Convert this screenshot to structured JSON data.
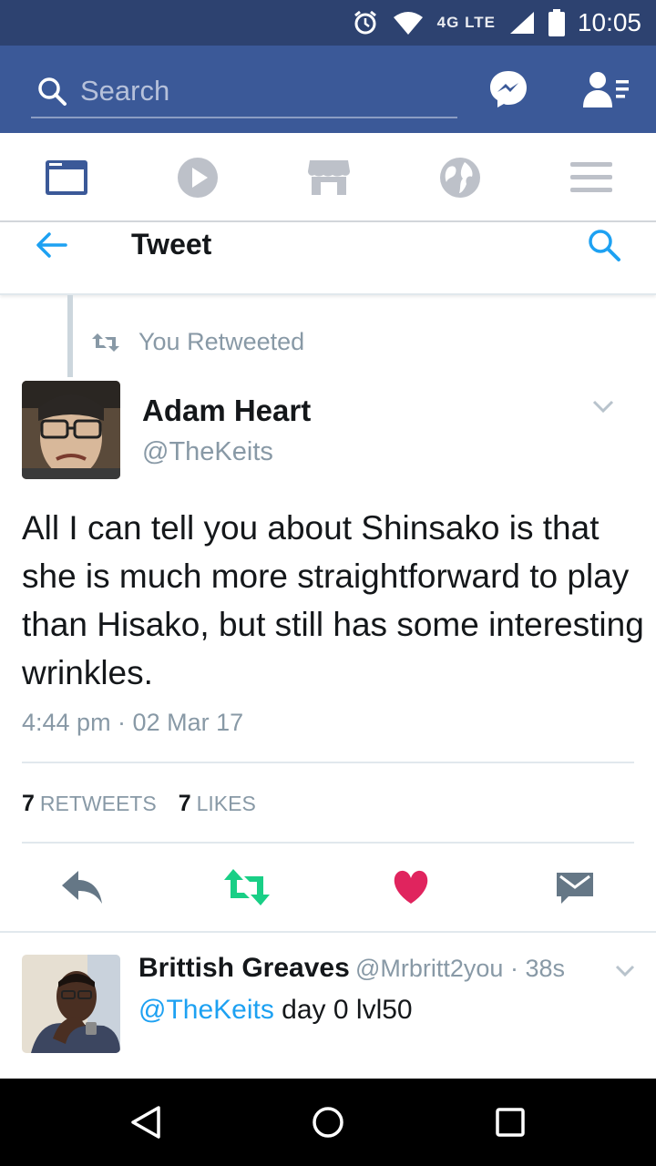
{
  "status_bar": {
    "network": "4G LTE",
    "time": "10:05"
  },
  "fb_header": {
    "search_placeholder": "Search"
  },
  "tweet_page": {
    "title": "Tweet"
  },
  "tweet": {
    "retweet_label": "You Retweeted",
    "author_name": "Adam Heart",
    "author_handle": "@TheKeits",
    "text": "All I can tell you about Shinsako is that she is much more straightforward to play than Hisako, but still has some interesting wrinkles.",
    "timestamp": "4:44 pm · 02 Mar 17",
    "retweet_count": "7",
    "retweets_label": "RETWEETS",
    "like_count": "7",
    "likes_label": "LIKES"
  },
  "reply": {
    "author_name": "Brittish Greaves",
    "meta": "@Mrbritt2you · 38s",
    "mention": "@TheKeits",
    "text": " day 0 lvl50"
  },
  "colors": {
    "fb_blue": "#3b5998",
    "status_bar": "#2d4270",
    "retweet_green": "#19cf86",
    "like_red": "#e0245e",
    "link_blue": "#1da1f2",
    "gray_text": "#8899a6"
  }
}
